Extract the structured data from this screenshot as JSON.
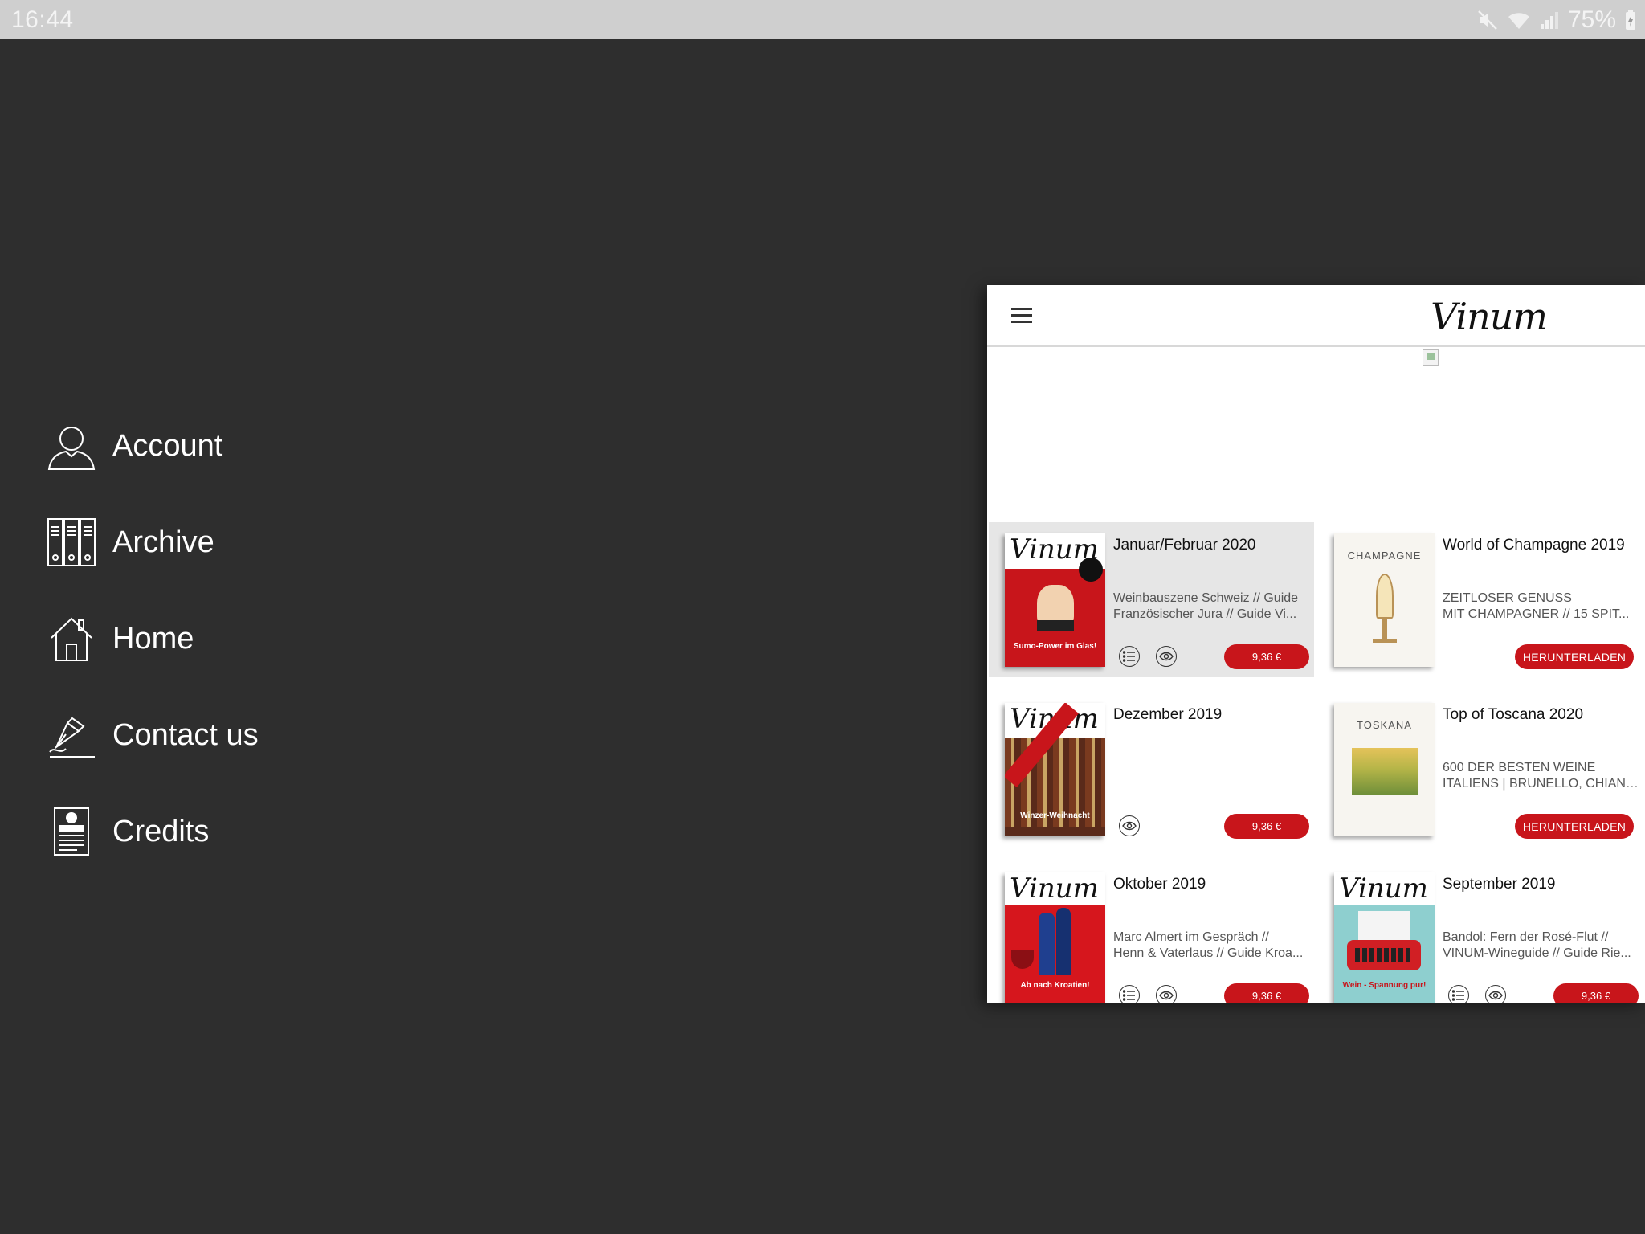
{
  "status_bar": {
    "time": "16:44",
    "battery": "75%",
    "icons": [
      "mute-icon",
      "wifi-icon",
      "signal-icon",
      "battery-charging-icon"
    ]
  },
  "menu": {
    "items": [
      {
        "label": "Account",
        "icon": "person-icon"
      },
      {
        "label": "Archive",
        "icon": "archive-binders-icon"
      },
      {
        "label": "Home",
        "icon": "house-icon"
      },
      {
        "label": "Contact us",
        "icon": "pen-icon"
      },
      {
        "label": "Credits",
        "icon": "credits-document-icon"
      }
    ]
  },
  "app": {
    "logo": "Vinum",
    "issues": [
      {
        "title": "Januar/Februar 2020",
        "desc": [
          "Weinbauszene Schweiz // Guide",
          "Französischer Jura // Guide Vi..."
        ],
        "action": "9,36 €",
        "cover_caption": "Sumo-Power im Glas!",
        "cover_color": "#c8151b"
      },
      {
        "title": "World of Champagne 2019",
        "desc": [
          "ZEITLOSER GENUSS",
          "MIT CHAMPAGNER // 15 SPIT..."
        ],
        "action": "HERUNTERLADEN",
        "cover_caption": "CHAMPAGNE",
        "cover_color": "#f7f5f0"
      },
      {
        "title": "Dezember 2019",
        "desc": [],
        "action": "9,36 €",
        "cover_caption": "Winzer-Weihnacht",
        "cover_color": "#5a2a1a"
      },
      {
        "title": "Top of Toscana 2020",
        "desc": [
          "600 DER BESTEN WEINE",
          "ITALIENS | BRUNELLO, CHIANT..."
        ],
        "action": "HERUNTERLADEN",
        "cover_caption": "TOSKANA",
        "cover_color": "#f7f5f0"
      },
      {
        "title": "Oktober 2019",
        "desc": [
          "Marc Almert im Gespräch //",
          "Henn & Vaterlaus // Guide Kroa..."
        ],
        "action": "9,36 €",
        "cover_caption": "Ab nach Kroatien!",
        "cover_color": "#d6161d"
      },
      {
        "title": "September 2019",
        "desc": [
          "Bandol: Fern der Rosé-Flut //",
          "VINUM-Wineguide // Guide Rie..."
        ],
        "action": "9,36 €",
        "cover_caption": "Wein - Spannung pur!",
        "cover_color": "#8ecfcf"
      }
    ]
  }
}
